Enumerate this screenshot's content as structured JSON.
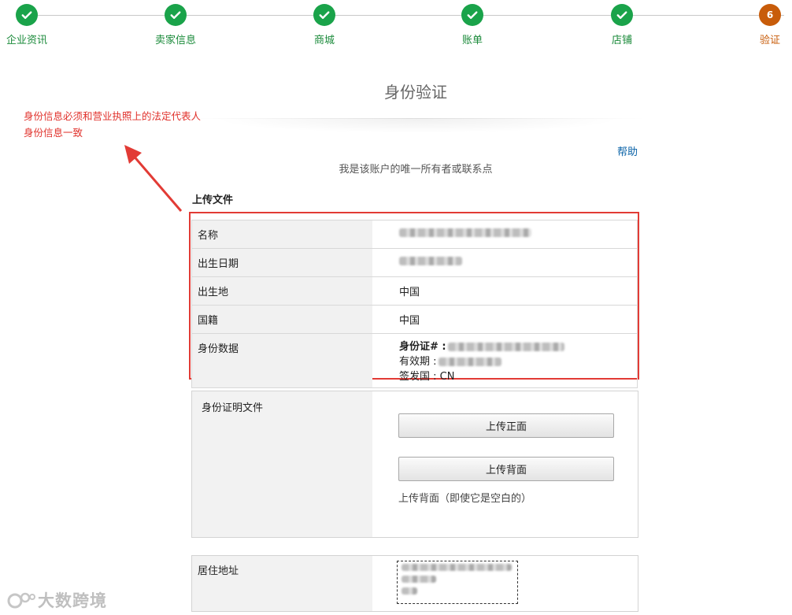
{
  "stepper": {
    "steps": [
      {
        "label": "企业资讯",
        "state": "done"
      },
      {
        "label": "卖家信息",
        "state": "done"
      },
      {
        "label": "商城",
        "state": "done"
      },
      {
        "label": "账单",
        "state": "done"
      },
      {
        "label": "店铺",
        "state": "done"
      },
      {
        "label": "验证",
        "state": "current",
        "number": "6"
      }
    ]
  },
  "annotation": {
    "line1": "身份信息必须和营业执照上的法定代表人",
    "line2": "身份信息一致"
  },
  "page": {
    "title": "身份验证",
    "help": "帮助",
    "subtitle": "我是该账户的唯一所有者或联系点",
    "section_title": "上传文件"
  },
  "info": {
    "name_label": "名称",
    "dob_label": "出生日期",
    "pob_label": "出生地",
    "pob_value": "中国",
    "nationality_label": "国籍",
    "nationality_value": "中国",
    "id_label": "身份数据",
    "id_number_label": "身份证# :",
    "expiry_label": "有效期 :",
    "issuer_label": "签发国 : CN"
  },
  "upload": {
    "label": "身份证明文件",
    "front_button": "上传正面",
    "back_button": "上传背面",
    "hint": "上传背面（即使它是空白的）"
  },
  "address": {
    "label": "居住地址"
  },
  "watermark": {
    "text": "大数跨境"
  },
  "colors": {
    "done": "#1aa34a",
    "current": "#c85c0a",
    "highlight": "#e23b35",
    "link": "#0b63a8"
  }
}
